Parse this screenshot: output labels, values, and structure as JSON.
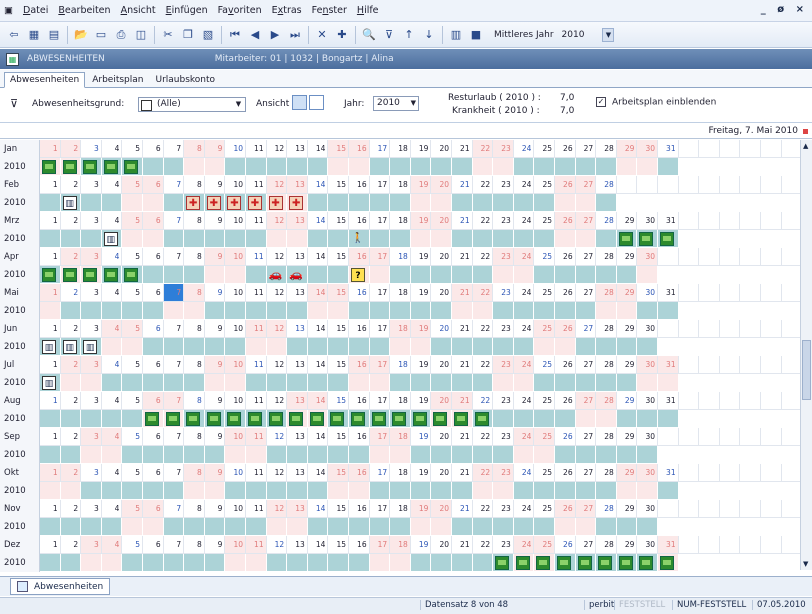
{
  "menu": [
    "Datei",
    "Bearbeiten",
    "Ansicht",
    "Einfügen",
    "Favoriten",
    "Extras",
    "Fenster",
    "Hilfe"
  ],
  "menu_underline": [
    "D",
    "B",
    "A",
    "E",
    "v",
    "x",
    "n",
    "H"
  ],
  "window_controls": "_ ø ×",
  "toolbar": {
    "year_label": "Mittleres Jahr",
    "year_value": "2010"
  },
  "title": {
    "section": "ABWESENHEITEN",
    "employee": "Mitarbeiter:  01 | 1032 | Bongartz | Alina"
  },
  "tabs": [
    "Abwesenheiten",
    "Arbeitsplan",
    "Urlaubskonto"
  ],
  "filter": {
    "grund_label": "Abwesenheitsgrund:",
    "grund_value": "(Alle)",
    "ansicht_label": "Ansicht",
    "jahr_label": "Jahr:",
    "jahr_value": "2010",
    "resturlaub_label": "Resturlaub ( 2010 ) :",
    "resturlaub_value": "7,0",
    "krankheit_label": "Krankheit ( 2010 ) :",
    "krankheit_value": "7,0",
    "arbeitsplan_label": "Arbeitsplan einblenden",
    "arbeitsplan_checked": true
  },
  "current_date": "Freitag, 7. Mai 2010",
  "calendar": {
    "year": "2010",
    "months": [
      {
        "name": "Jan",
        "days": 31,
        "start": 5
      },
      {
        "name": "Feb",
        "days": 28,
        "start": 1
      },
      {
        "name": "Mrz",
        "days": 31,
        "start": 1
      },
      {
        "name": "Apr",
        "days": 30,
        "start": 4
      },
      {
        "name": "Mai",
        "days": 31,
        "start": 6
      },
      {
        "name": "Jun",
        "days": 30,
        "start": 2
      },
      {
        "name": "Jul",
        "days": 31,
        "start": 4
      },
      {
        "name": "Aug",
        "days": 31,
        "start": 0
      },
      {
        "name": "Sep",
        "days": 30,
        "start": 3
      },
      {
        "name": "Okt",
        "days": 31,
        "start": 5
      },
      {
        "name": "Nov",
        "days": 30,
        "start": 1
      },
      {
        "name": "Dez",
        "days": 31,
        "start": 3
      }
    ],
    "absences": [
      {
        "month": 0,
        "days": [
          1,
          2,
          3,
          4,
          5
        ],
        "type": "vac"
      },
      {
        "month": 1,
        "days": [
          2
        ],
        "type": "book"
      },
      {
        "month": 1,
        "days": [
          8,
          9,
          10,
          11,
          12,
          13
        ],
        "type": "sick"
      },
      {
        "month": 2,
        "days": [
          4
        ],
        "type": "book"
      },
      {
        "month": 2,
        "days": [
          16
        ],
        "type": "walk"
      },
      {
        "month": 2,
        "days": [
          29,
          30,
          31
        ],
        "type": "vac"
      },
      {
        "month": 3,
        "days": [
          1,
          2,
          3,
          4,
          5
        ],
        "type": "vac"
      },
      {
        "month": 3,
        "days": [
          12,
          13
        ],
        "type": "car"
      },
      {
        "month": 3,
        "days": [
          16
        ],
        "type": "q"
      },
      {
        "month": 5,
        "days": [
          1,
          2,
          3
        ],
        "type": "book"
      },
      {
        "month": 6,
        "days": [
          1
        ],
        "type": "book"
      },
      {
        "month": 7,
        "days": [
          6,
          7,
          8,
          9,
          10,
          11,
          12,
          13,
          14,
          15,
          16,
          17,
          18,
          19,
          20,
          21,
          22
        ],
        "type": "vac"
      },
      {
        "month": 11,
        "days": [
          23,
          24,
          25,
          26,
          27,
          28,
          29,
          30,
          31
        ],
        "type": "vac"
      }
    ],
    "today": {
      "month": 4,
      "day": 7
    }
  },
  "bottom_tab": "Abwesenheiten",
  "status": {
    "record": "Datensatz  8 von 48",
    "user": "perbit",
    "caps": "FESTSTELL",
    "num": "NUM-FESTSTELL",
    "date": "07.05.2010"
  }
}
